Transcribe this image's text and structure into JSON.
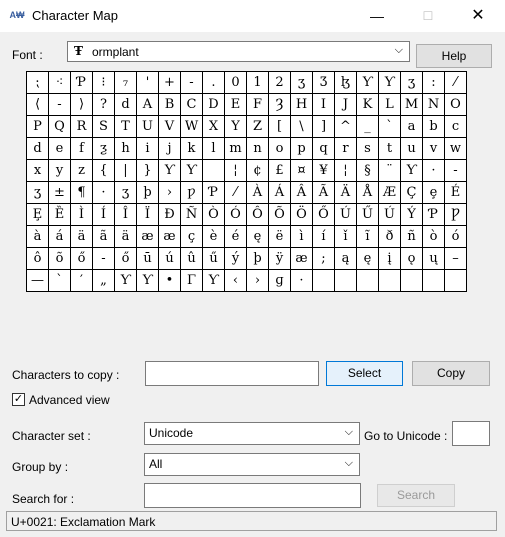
{
  "window": {
    "icon_text": "A₩",
    "title": "Character Map",
    "minimize": "—",
    "maximize": "☐",
    "close": "✕"
  },
  "font": {
    "label": "Font :",
    "value": "ormplant",
    "type_icon": "Ŧ",
    "help": "Help"
  },
  "grid": {
    "rows": [
      [
        "⁏",
        "⁖",
        "Ƥ",
        "⁝",
        "₇",
        "'",
        "+",
        "-",
        ".",
        "0",
        "1",
        "2",
        "ʒ",
        "Ʒ",
        "ɮ",
        "Ƴ",
        "Ƴ",
        "ʒ",
        ":",
        "⁄"
      ],
      [
        "⟨",
        "-",
        "⟩",
        "?",
        "d",
        "A",
        "B",
        "C",
        "D",
        "E",
        "F",
        "Ȝ",
        "H",
        "I",
        "J",
        "K",
        "L",
        "M",
        "N",
        "O"
      ],
      [
        "P",
        "Q",
        "R",
        "S",
        "T",
        "U",
        "V",
        "W",
        "X",
        "Y",
        "Z",
        "[",
        "\\",
        "]",
        "^",
        "_",
        "`",
        "a",
        "b",
        "c"
      ],
      [
        "d",
        "e",
        "f",
        "ƺ",
        "h",
        "i",
        "j",
        "k",
        "l",
        "m",
        "n",
        "o",
        "p",
        "q",
        "r",
        "s",
        "t",
        "u",
        "v",
        "w"
      ],
      [
        "x",
        "y",
        "z",
        "{",
        "|",
        "}",
        "Ƴ",
        "Ƴ",
        "",
        "¦",
        "¢",
        "£",
        "¤",
        "¥",
        "¦",
        "§",
        "¨",
        "Ƴ",
        "·",
        "-"
      ],
      [
        "ʒ",
        "±",
        "¶",
        "·",
        "ʒ",
        "þ",
        "›",
        "ƿ",
        "Ƥ",
        "⁄",
        "À",
        "Á",
        "Â",
        "Ã",
        "Ä",
        "Å",
        "Æ",
        "Ç",
        "ȩ",
        "É"
      ],
      [
        "Ȩ",
        "Ȅ",
        "Ì",
        "Í",
        "Î",
        "Ï",
        "Ð",
        "Ñ",
        "Ò",
        "Ó",
        "Ô",
        "Õ",
        "Ö",
        "Ő",
        "Ú",
        "Ű",
        "Ú",
        "Ý",
        "Ƥ",
        "Ƿ"
      ],
      [
        "à",
        "á",
        "ä",
        "ã",
        "ä",
        "æ",
        "æ",
        "ç",
        "è",
        "é",
        "ę",
        "ë",
        "ì",
        "í",
        "ǐ",
        "ĩ",
        "ð",
        "ñ",
        "ò",
        "ó"
      ],
      [
        "ô",
        "õ",
        "ő",
        "-",
        "ő",
        "ū",
        "ú",
        "û",
        "ű",
        "ý",
        "þ",
        "ÿ",
        "æ",
        ";",
        "ą",
        "ę",
        "į",
        "ǫ",
        "ų",
        "–"
      ],
      [
        "—",
        "`",
        "′",
        "„",
        "Ƴ",
        "Ƴ",
        "•",
        "Γ",
        "Ƴ",
        "‹",
        "›",
        "ɡ",
        "·",
        "",
        "",
        "",
        "",
        "",
        "",
        ""
      ]
    ]
  },
  "copy": {
    "label": "Characters to copy :",
    "value": "",
    "select": "Select",
    "copy": "Copy"
  },
  "advanced": {
    "label": "Advanced view",
    "checked": "✓"
  },
  "charset": {
    "label": "Character set :",
    "value": "Unicode",
    "goto_label": "Go to Unicode :",
    "goto_value": ""
  },
  "groupby": {
    "label": "Group by :",
    "value": "All"
  },
  "search": {
    "label": "Search for :",
    "value": "",
    "button": "Search"
  },
  "status": {
    "text": "U+0021: Exclamation Mark"
  },
  "icons": {
    "chevron": "⌵"
  }
}
